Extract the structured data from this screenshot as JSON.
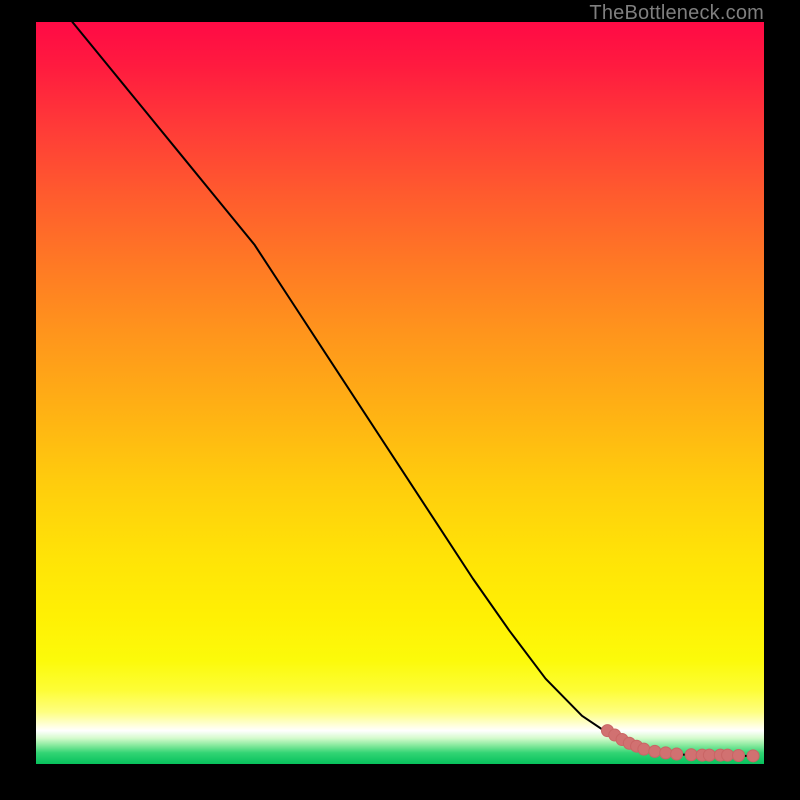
{
  "attribution": "TheBottleneck.com",
  "colors": {
    "curve_stroke": "#000000",
    "marker_fill": "#d17171",
    "marker_stroke": "#c96565",
    "frame_bg": "#000000"
  },
  "chart_data": {
    "type": "line",
    "title": "",
    "xlabel": "",
    "ylabel": "",
    "xlim": [
      0,
      100
    ],
    "ylim": [
      0,
      100
    ],
    "grid": false,
    "legend": false,
    "series": [
      {
        "name": "curve",
        "x": [
          5,
          10,
          15,
          20,
          25,
          30,
          35,
          40,
          45,
          50,
          55,
          60,
          65,
          70,
          75,
          80,
          81.5,
          83,
          85,
          88,
          91,
          94,
          97,
          99
        ],
        "y": [
          100,
          94,
          88,
          82,
          76,
          70,
          62.5,
          55,
          47.5,
          40,
          32.5,
          25,
          18,
          11.5,
          6.5,
          3.2,
          2.6,
          2.1,
          1.6,
          1.3,
          1.2,
          1.15,
          1.1,
          1.1
        ]
      }
    ],
    "markers": {
      "name": "highlight-points",
      "x": [
        78.5,
        79.5,
        80.5,
        81.5,
        82.5,
        83.5,
        85,
        86.5,
        88,
        90,
        91.5,
        92.5,
        94,
        95,
        96.5,
        98.5
      ],
      "y": [
        4.5,
        3.9,
        3.3,
        2.8,
        2.4,
        2.0,
        1.7,
        1.5,
        1.35,
        1.25,
        1.2,
        1.2,
        1.2,
        1.2,
        1.15,
        1.1
      ]
    }
  }
}
